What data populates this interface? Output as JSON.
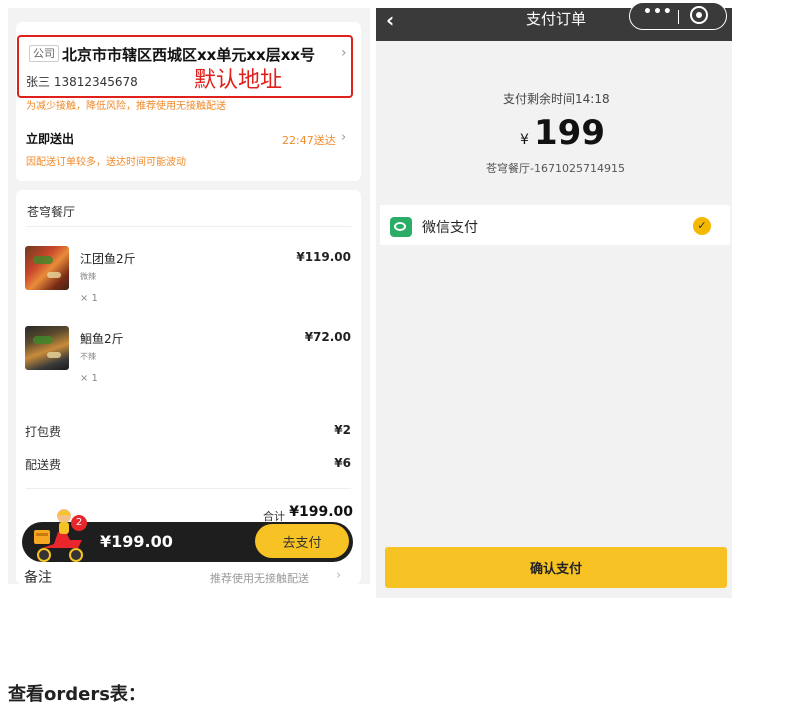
{
  "order": {
    "address": {
      "tag": "公司",
      "line": "北京市市辖区西城区xx单元xx层xx号",
      "contact": "张三 13812345678",
      "annotation": "默认地址",
      "safety_tip": "为减少接触，降低风险，推荐使用无接触配送",
      "chevron": "›"
    },
    "delivery": {
      "label": "立即送出",
      "time": "22:47送达",
      "note": "因配送订单较多，送达时间可能波动",
      "chevron": "›"
    },
    "shop_name": "苍穹餐厅",
    "items": [
      {
        "name": "江团鱼2斤",
        "spec": "微辣",
        "qty": "× 1",
        "price": "¥119.00"
      },
      {
        "name": "鮰鱼2斤",
        "spec": "不辣",
        "qty": "× 1",
        "price": "¥72.00"
      }
    ],
    "fees": [
      {
        "label": "打包费",
        "value": "¥2"
      },
      {
        "label": "配送费",
        "value": "¥6"
      }
    ],
    "total_label": "合计",
    "total_value": "¥199.00",
    "cart": {
      "badge": "2",
      "price": "¥199.00",
      "pay_label": "去支付"
    },
    "remark": {
      "label": "备注",
      "hint": "推荐使用无接触配送",
      "chevron": "›"
    }
  },
  "payment": {
    "nav_title": "支付订单",
    "back": "‹",
    "capsule_more": "•••",
    "remaining": "支付剩余时间14:18",
    "currency": "¥",
    "amount": "199",
    "merchant": "苍穹餐厅-1671025714915",
    "method": "微信支付",
    "check": "✓",
    "confirm_label": "确认支付"
  },
  "page_heading": "查看orders表：",
  "colors": {
    "accent_yellow": "#f7c223",
    "highlight_red": "#e0201b",
    "tip_orange": "#f08a2a",
    "wechat_green": "#2aae67"
  }
}
